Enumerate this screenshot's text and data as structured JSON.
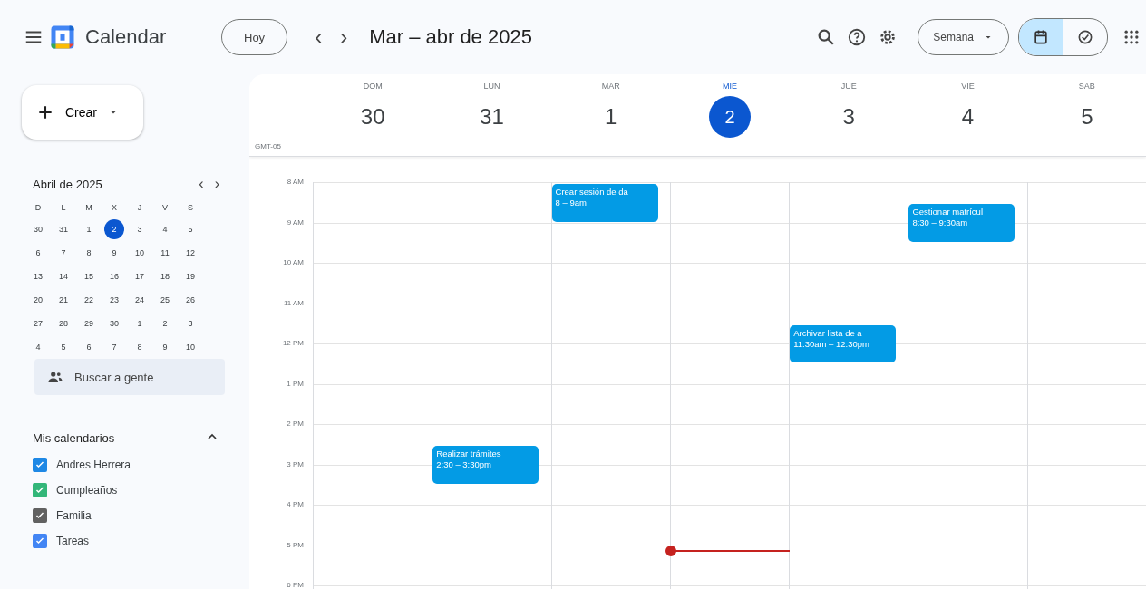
{
  "header": {
    "app_name": "Calendar",
    "today_button": "Hoy",
    "prev": "‹",
    "next": "›",
    "range_title": "Mar – abr de 2025",
    "view_select": "Semana",
    "views": [
      {
        "kind": "calendar",
        "selected": true
      },
      {
        "kind": "tasks",
        "selected": false
      }
    ]
  },
  "sidebar": {
    "create_button": "Crear",
    "mini_calendar": {
      "title": "Abril de 2025",
      "prev": "‹",
      "next": "›",
      "weekdays": [
        "D",
        "L",
        "M",
        "X",
        "J",
        "V",
        "S"
      ],
      "weeks": [
        [
          {
            "label": "30",
            "selected": false
          },
          {
            "label": "31",
            "selected": false
          },
          {
            "label": "1",
            "selected": false
          },
          {
            "label": "2",
            "selected": true
          },
          {
            "label": "3",
            "selected": false
          },
          {
            "label": "4",
            "selected": false
          },
          {
            "label": "5",
            "selected": false
          }
        ],
        [
          {
            "label": "6",
            "selected": false
          },
          {
            "label": "7",
            "selected": false
          },
          {
            "label": "8",
            "selected": false
          },
          {
            "label": "9",
            "selected": false
          },
          {
            "label": "10",
            "selected": false
          },
          {
            "label": "11",
            "selected": false
          },
          {
            "label": "12",
            "selected": false
          }
        ],
        [
          {
            "label": "13",
            "selected": false
          },
          {
            "label": "14",
            "selected": false
          },
          {
            "label": "15",
            "selected": false
          },
          {
            "label": "16",
            "selected": false
          },
          {
            "label": "17",
            "selected": false
          },
          {
            "label": "18",
            "selected": false
          },
          {
            "label": "19",
            "selected": false
          }
        ],
        [
          {
            "label": "20",
            "selected": false
          },
          {
            "label": "21",
            "selected": false
          },
          {
            "label": "22",
            "selected": false
          },
          {
            "label": "23",
            "selected": false
          },
          {
            "label": "24",
            "selected": false
          },
          {
            "label": "25",
            "selected": false
          },
          {
            "label": "26",
            "selected": false
          }
        ],
        [
          {
            "label": "27",
            "selected": false
          },
          {
            "label": "28",
            "selected": false
          },
          {
            "label": "29",
            "selected": false
          },
          {
            "label": "30",
            "selected": false
          },
          {
            "label": "1",
            "selected": false
          },
          {
            "label": "2",
            "selected": false
          },
          {
            "label": "3",
            "selected": false
          }
        ],
        [
          {
            "label": "4",
            "selected": false
          },
          {
            "label": "5",
            "selected": false
          },
          {
            "label": "6",
            "selected": false
          },
          {
            "label": "7",
            "selected": false
          },
          {
            "label": "8",
            "selected": false
          },
          {
            "label": "9",
            "selected": false
          },
          {
            "label": "10",
            "selected": false
          }
        ]
      ]
    },
    "people_search": {
      "placeholder": "Buscar a gente"
    },
    "my_calendars": {
      "title": "Mis calendarios",
      "expanded": true,
      "items": [
        {
          "name": "Andres Herrera",
          "checked": true,
          "color": "#1e88e5"
        },
        {
          "name": "Cumpleaños",
          "checked": true,
          "color": "#33b679"
        },
        {
          "name": "Familia",
          "checked": true,
          "color": "#616161"
        },
        {
          "name": "Tareas",
          "checked": true,
          "color": "#4285f4"
        }
      ]
    }
  },
  "week": {
    "timezone": "GMT-05",
    "hours": [
      "8 AM",
      "9 AM",
      "10 AM",
      "11 AM",
      "12 PM",
      "1 PM",
      "2 PM",
      "3 PM",
      "4 PM",
      "5 PM",
      "6 PM"
    ],
    "days": [
      {
        "weekday": "DOM",
        "date": "30",
        "selected": false
      },
      {
        "weekday": "LUN",
        "date": "31",
        "selected": false,
        "events": [
          {
            "title": "Realizar trámites",
            "time": "2:30 – 3:30pm"
          }
        ]
      },
      {
        "weekday": "MAR",
        "date": "1",
        "selected": false,
        "events": [
          {
            "title": "Crear sesión de da",
            "time": "8 – 9am"
          }
        ]
      },
      {
        "weekday": "MIÉ",
        "date": "2",
        "selected": true,
        "now": true
      },
      {
        "weekday": "JUE",
        "date": "3",
        "selected": false,
        "events": [
          {
            "title": "Archivar lista de a",
            "time": "11:30am – 12:30pm"
          }
        ]
      },
      {
        "weekday": "VIE",
        "date": "4",
        "selected": false,
        "events": [
          {
            "title": "Gestionar matrícul",
            "time": "8:30 – 9:30am"
          }
        ]
      },
      {
        "weekday": "SÁB",
        "date": "5",
        "selected": false
      }
    ]
  }
}
